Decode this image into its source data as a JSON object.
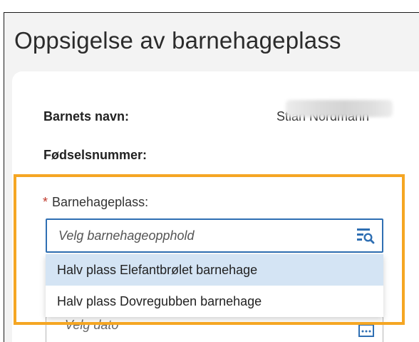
{
  "page": {
    "title": "Oppsigelse av barnehageplass"
  },
  "info": {
    "child_name_label": "Barnets navn:",
    "child_name_value": "Stian Nordmann",
    "ssn_label": "Fødselsnummer:"
  },
  "kindergarten": {
    "required_marker": "*",
    "label": "Barnehageplass:",
    "placeholder": "Velg barnehageopphold",
    "icon": "list-search-icon",
    "options": [
      "Halv plass Elefantbrølet barnehage",
      "Halv plass Dovregubben barnehage"
    ],
    "highlighted_option_index": 0
  },
  "date": {
    "placeholder": "Velg dato",
    "icon": "calendar-icon"
  },
  "colors": {
    "accent_border": "#2f6fb3",
    "highlight_frame": "#f5a623",
    "option_hover": "#d4e4f4",
    "required": "#c0392b"
  }
}
